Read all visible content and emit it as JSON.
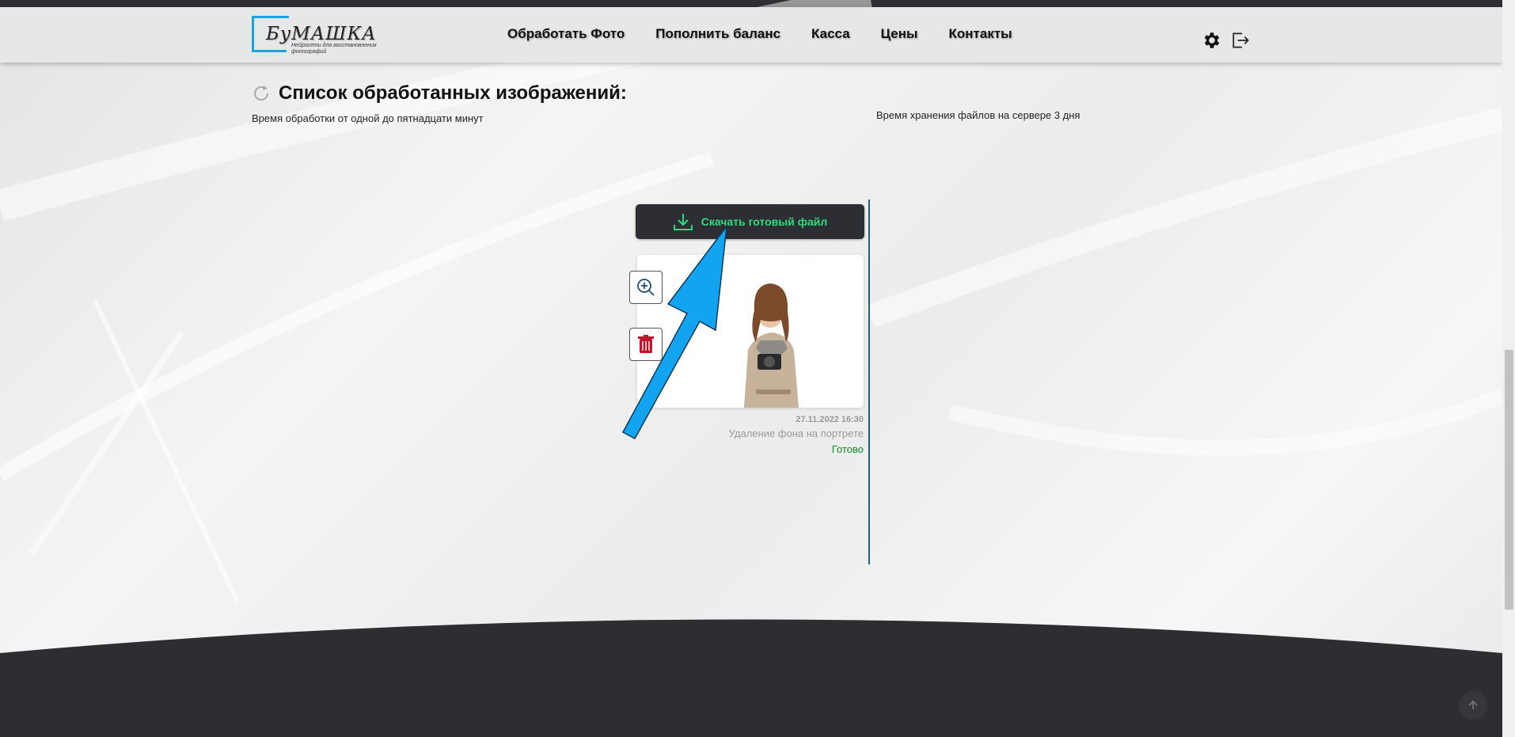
{
  "header": {
    "logo": {
      "name": "БуМАШКА",
      "tagline": "Нейросети для восстановления фотографий"
    },
    "nav": [
      {
        "label": "Обработать Фото"
      },
      {
        "label": "Пополнить баланс"
      },
      {
        "label": "Касса"
      },
      {
        "label": "Цены"
      },
      {
        "label": "Контакты"
      }
    ],
    "icons": [
      "gear-icon",
      "logout-icon"
    ]
  },
  "main": {
    "title": "Список обработанных изображений:",
    "processing_time": "Время обработки от одной до пятнадцати минут",
    "storage_time": "Время хранения файлов на сервере 3 дня"
  },
  "item": {
    "download_label": "Скачать готовый файл",
    "date": "27.11.2022 16:30",
    "operation": "Удаление фона на портрете",
    "status": "Готово",
    "icons": [
      "download-icon",
      "zoom-in-icon",
      "trash-icon"
    ]
  },
  "colors": {
    "accent_green": "#2fdc7d",
    "status_green": "#0a8a2a",
    "logo_blue": "#19a3e0",
    "dark": "#2d2e33",
    "arrow_blue": "#12a4f0"
  }
}
